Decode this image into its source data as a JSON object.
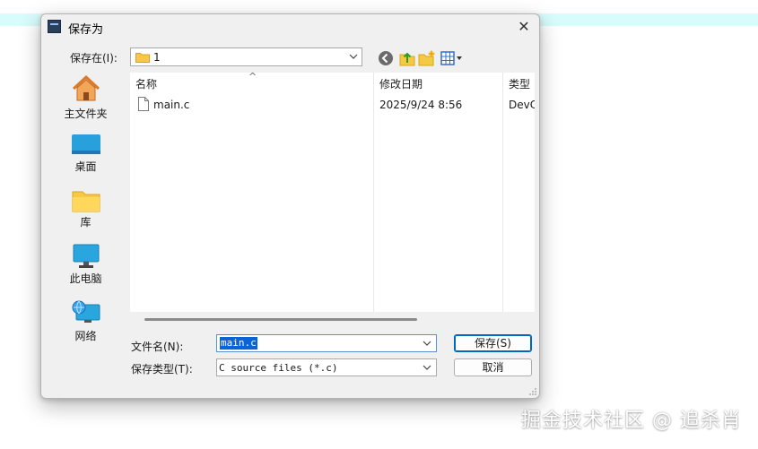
{
  "dialog": {
    "title": "保存为",
    "close_glyph": "✕"
  },
  "lookin": {
    "label": "保存在(I):",
    "value": "1"
  },
  "places": [
    {
      "label": "主文件夹",
      "icon": "home-icon"
    },
    {
      "label": "桌面",
      "icon": "desktop-icon"
    },
    {
      "label": "库",
      "icon": "library-folder-icon"
    },
    {
      "label": "此电脑",
      "icon": "computer-icon"
    },
    {
      "label": "网络",
      "icon": "network-icon"
    }
  ],
  "filelist": {
    "columns": [
      "名称",
      "修改日期",
      "类型"
    ],
    "sort_indicator": "^",
    "rows": [
      {
        "name": "main.c",
        "date": "2025/9/24 8:56",
        "type": "DevC"
      }
    ]
  },
  "filename": {
    "label": "文件名(N):",
    "value": "main.c"
  },
  "filetype": {
    "label": "保存类型(T):",
    "value": "C source files (*.c)"
  },
  "buttons": {
    "save": "保存(S)",
    "cancel": "取消"
  },
  "watermark": "掘金技术社区 @ 追杀肖",
  "colors": {
    "selection": "#0a64d8",
    "focus_border": "#0067c0",
    "dialog_bg": "#f0f0f0",
    "strip": "#d8fbfb"
  }
}
